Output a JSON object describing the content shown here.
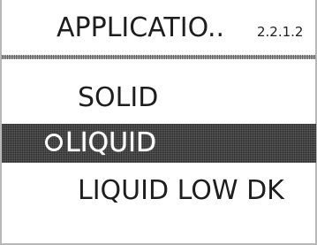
{
  "header": {
    "title": "APPLICATIO..",
    "menu_id": "2.2.1.2"
  },
  "options": [
    {
      "label": "SOLID",
      "selected": false
    },
    {
      "label": "LIQUID",
      "selected": true
    },
    {
      "label": "LIQUID LOW DK",
      "selected": false
    }
  ],
  "colors": {
    "background": "#ffffff",
    "text": "#1e1e1e",
    "highlight": "#2b2b2b",
    "highlight_text": "#ffffff"
  },
  "icons": {
    "selected_marker": "radio-selected-icon"
  }
}
